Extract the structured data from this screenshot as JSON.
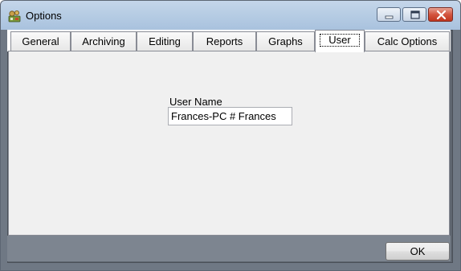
{
  "window": {
    "title": "Options",
    "app_icon": "options-app-icon",
    "controls": {
      "minimize": "minimize-icon",
      "maximize": "maximize-icon",
      "close": "close-icon"
    }
  },
  "tabs": [
    {
      "label": "General",
      "active": false
    },
    {
      "label": "Archiving",
      "active": false
    },
    {
      "label": "Editing",
      "active": false
    },
    {
      "label": "Reports",
      "active": false
    },
    {
      "label": "Graphs",
      "active": false
    },
    {
      "label": "User",
      "active": true
    },
    {
      "label": "Calc Options",
      "active": false
    }
  ],
  "user_panel": {
    "user_name_label": "User Name",
    "user_name_value": "Frances-PC # Frances"
  },
  "footer": {
    "ok_label": "OK"
  },
  "colors": {
    "titlebar": "#b7cde4",
    "panel": "#f0f0f0",
    "close_button": "#c0361f",
    "frame": "#6f7884"
  }
}
